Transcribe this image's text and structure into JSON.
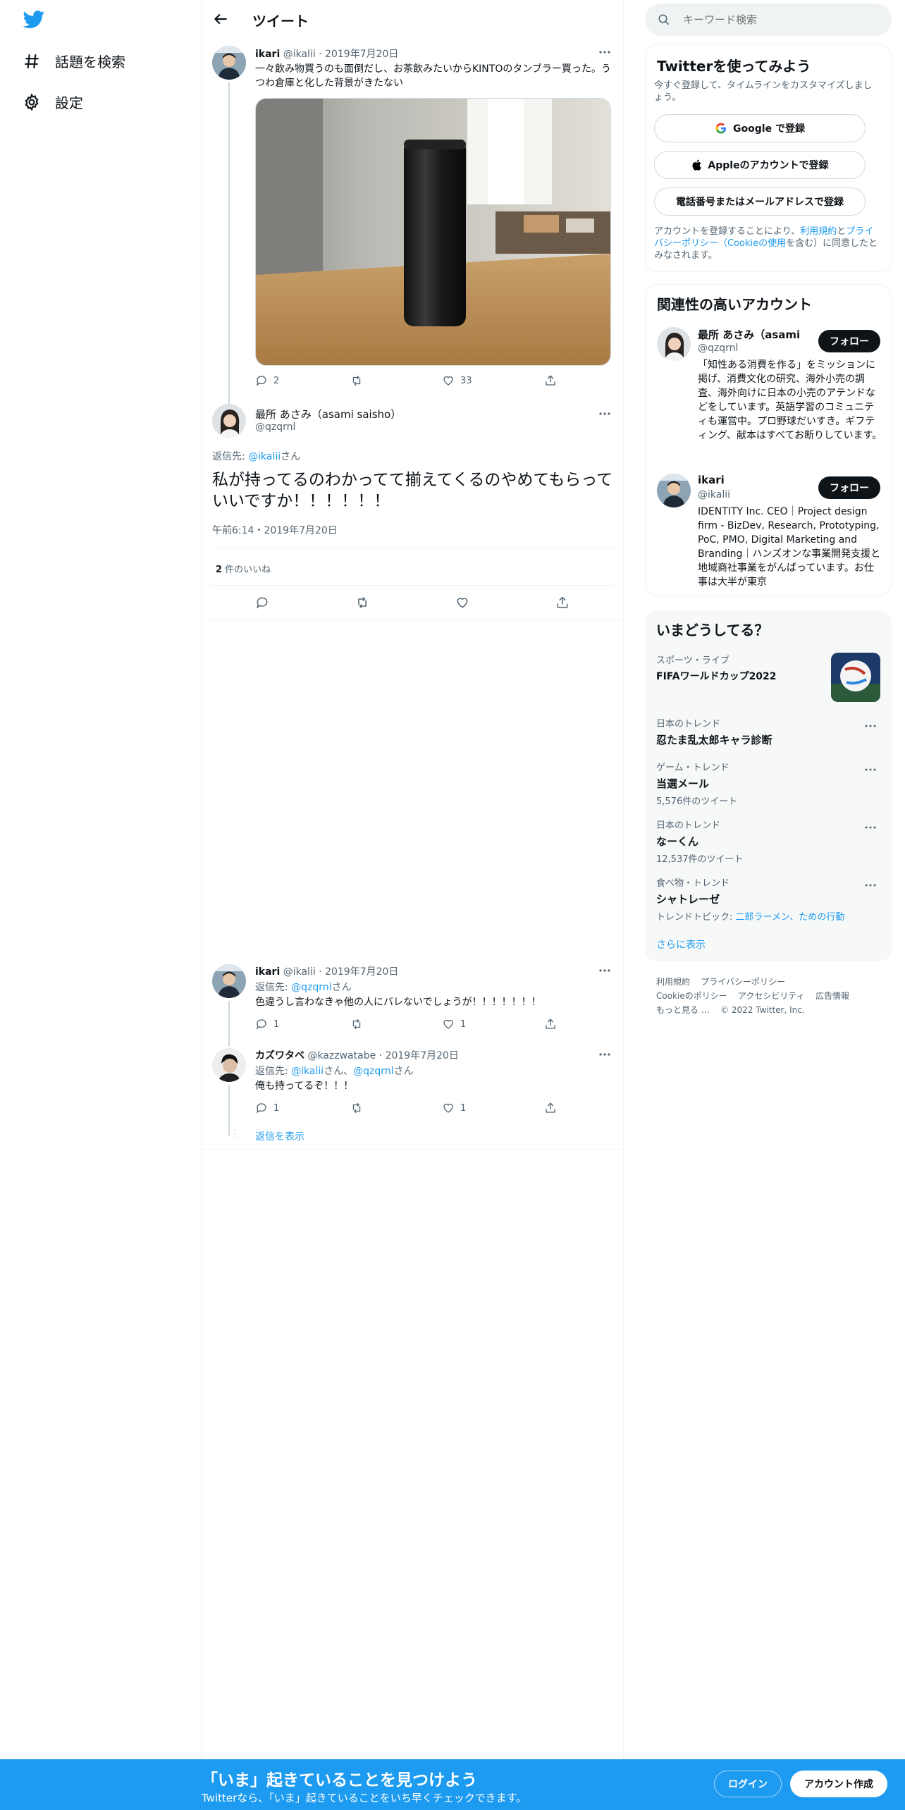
{
  "nav": {
    "explore_label": "話題を検索",
    "settings_label": "設定"
  },
  "header": {
    "title": "ツイート"
  },
  "tweet1": {
    "name": "ikari",
    "handle": "@ikalii",
    "date": "2019年7月20日",
    "text": "一々飲み物買うのも面倒だし、お茶飲みたいからKINTOのタンブラー買った。うつわ倉庫と化した背景がきたない",
    "replies": "2",
    "likes": "33"
  },
  "main_tweet": {
    "name": "最所 あさみ（asami saisho）",
    "handle": "@qzqrnl",
    "reply_prefix": "返信先: ",
    "reply_to": "@ikalii",
    "reply_suffix": "さん",
    "text": "私が持ってるのわかってて揃えてくるのやめてもらっていいですか！！！！！！",
    "timestamp": "午前6:14・2019年7月20日",
    "likes_count": "2",
    "likes_label": " 件のいいね"
  },
  "reply1": {
    "name": "ikari",
    "handle": "@ikalii",
    "date": "2019年7月20日",
    "reply_prefix": "返信先: ",
    "reply_to": "@qzqrnl",
    "reply_suffix": "さん",
    "text": "色違うし言わなきゃ他の人にバレないでしょうが！！！！！！！",
    "replies": "1",
    "likes": "1"
  },
  "reply2": {
    "name": "カズワタベ",
    "handle": "@kazzwatabe",
    "date": "2019年7月20日",
    "reply_prefix": "返信先: ",
    "reply_to1": "@ikalii",
    "reply_mid": "さん、",
    "reply_to2": "@qzqrnl",
    "reply_suffix": "さん",
    "text": "俺も持ってるぞ！！！",
    "replies": "1",
    "likes": "1"
  },
  "show_replies": "返信を表示",
  "search": {
    "placeholder": "キーワード検索"
  },
  "signup_card": {
    "title": "Twitterを使ってみよう",
    "subtitle": "今すぐ登録して、タイムラインをカスタマイズしましょう。",
    "google": "Google で登録",
    "apple": "Appleのアカウントで登録",
    "phone": "電話番号またはメールアドレスで登録",
    "terms_pre": "アカウントを登録することにより、",
    "terms_link": "利用規約",
    "terms_and": "と",
    "privacy_link": "プライバシーポリシー（Cookieの使用",
    "terms_post": "を含む）に同意したとみなされます。"
  },
  "related": {
    "title": "関連性の高いアカウント",
    "follow_label": "フォロー",
    "accounts": [
      {
        "name": "最所 あさみ（asami ...",
        "handle": "@qzqrnl",
        "bio": "「知性ある消費を作る」をミッションに掲げ、消費文化の研究、海外小売の調査、海外向けに日本の小売のアテンドなどをしています。英語学習のコミュニティも運営中。プロ野球だいすき。ギフティング、献本はすべてお断りしています。"
      },
      {
        "name": "ikari",
        "handle": "@ikalii",
        "bio": "IDENTITY Inc. CEO｜Project design firm - BizDev, Research, Prototyping, PoC, PMO, Digital Marketing and Branding｜ハンズオンな事業開発支援と地域商社事業をがんばっています。お仕事は大半が東京"
      }
    ]
  },
  "trends": {
    "title": "いまどうしてる？",
    "items": [
      {
        "category": "スポーツ・ライブ",
        "name": "FIFAワールドカップ2022",
        "count": ""
      },
      {
        "category": "日本のトレンド",
        "name": "忍たま乱太郎キャラ診断",
        "count": ""
      },
      {
        "category": "ゲーム・トレンド",
        "name": "当選メール",
        "count": "5,576件のツイート"
      },
      {
        "category": "日本のトレンド",
        "name": "なーくん",
        "count": "12,537件のツイート"
      },
      {
        "category": "食べ物・トレンド",
        "name": "シャトレーゼ",
        "count_prefix": "トレンドトピック: ",
        "count_links": "二郎ラーメン、ための行動"
      }
    ],
    "show_more": "さらに表示"
  },
  "footer": {
    "row1": [
      "利用規約",
      "プライバシーポリシー"
    ],
    "row2": [
      "Cookieのポリシー",
      "アクセシビリティ",
      "広告情報"
    ],
    "row3_more": "もっと見る …",
    "copyright": "© 2022 Twitter, Inc."
  },
  "bottom_bar": {
    "headline": "「いま」起きていることを見つけよう",
    "sub": "Twitterなら、「いま」起きていることをいち早くチェックできます。",
    "login": "ログイン",
    "signup": "アカウント作成"
  },
  "colors": {
    "accent": "#1d9bf0",
    "text": "#0f1419",
    "muted": "#536471"
  }
}
